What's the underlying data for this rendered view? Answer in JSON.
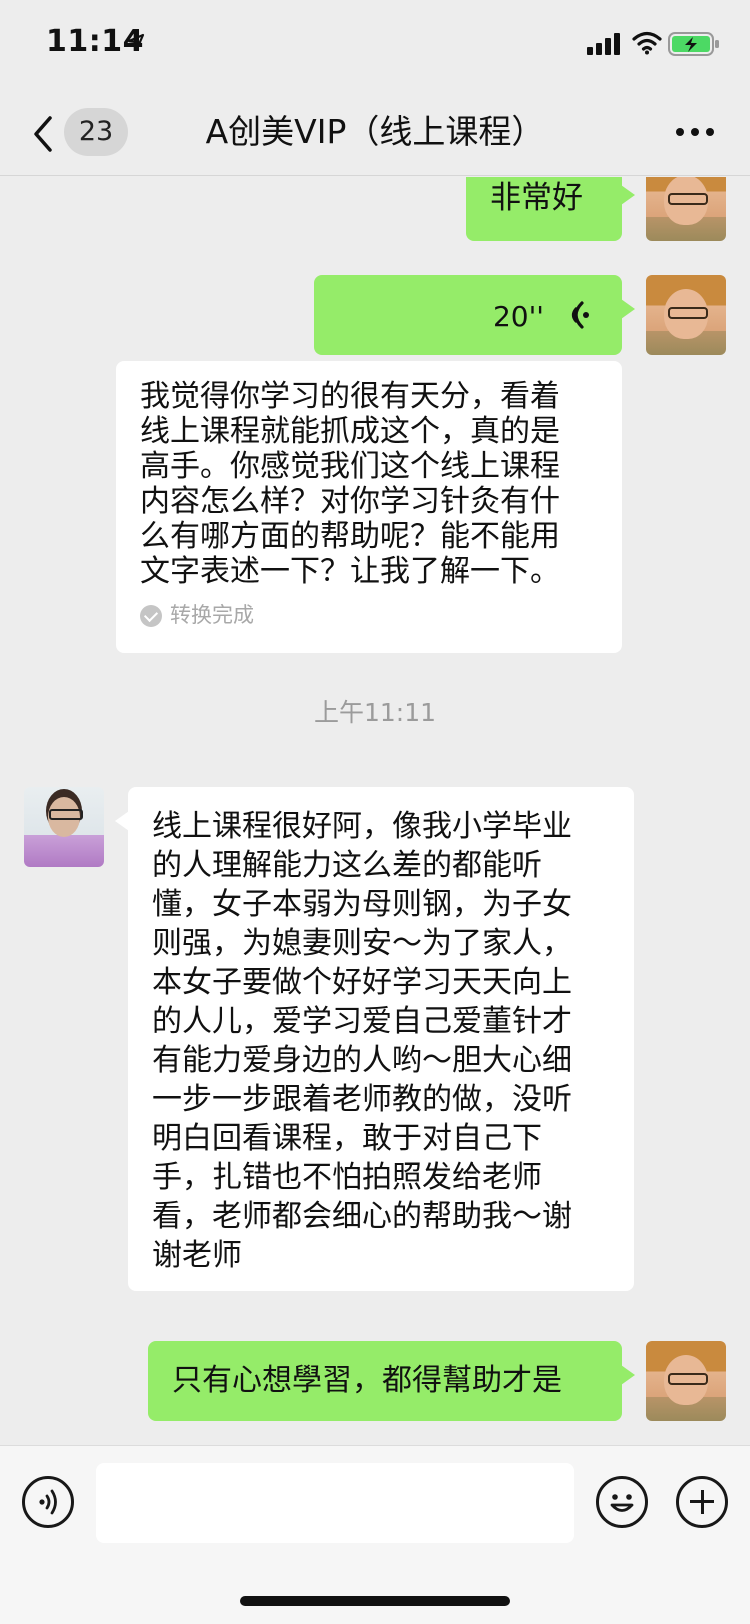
{
  "status_bar": {
    "time": "11:14",
    "icons": [
      "location-arrow-icon",
      "cellular-signal-icon",
      "wifi-icon",
      "battery-charging-icon"
    ]
  },
  "nav": {
    "unread_count": "23",
    "title": "A创美VIP（线上课程）",
    "icons": [
      "back-chevron-icon",
      "more-dots-icon"
    ]
  },
  "messages": [
    {
      "sender": "self",
      "type": "text",
      "text": "非常好"
    },
    {
      "sender": "self",
      "type": "voice",
      "duration": "20''",
      "transcript": "我觉得你学习的很有天分，看着\n线上课程就能抓成这个，真的是\n高手。你感觉我们这个线上课程\n内容怎么样？对你学习针灸有什\n么有哪方面的帮助呢？能不能用\n文字表述一下？让我了解一下。",
      "transcript_status": "转换完成"
    },
    {
      "type": "timestamp",
      "text": "上午11:11"
    },
    {
      "sender": "other",
      "type": "text",
      "text": "线上课程很好阿，像我小学毕业\n的人理解能力这么差的都能听\n懂，女子本弱为母则钢，为子女\n则强，为媳妻则安～为了家人，\n本女子要做个好好学习天天向上\n的人儿，爱学习爱自己爱董针才\n有能力爱身边的人哟～胆大心细\n一步一步跟着老师教的做，没听\n明白回看课程，敢于对自己下\n手，扎错也不怕拍照发给老师\n看，老师都会细心的帮助我～谢\n谢老师"
    },
    {
      "sender": "self",
      "type": "text",
      "text": "只有心想學習，都得幫助才是"
    }
  ],
  "input_bar": {
    "placeholder": "",
    "icons": [
      "voice-mode-icon",
      "emoji-icon",
      "plus-icon"
    ]
  },
  "colors": {
    "self_bubble": "#95ec69",
    "other_bubble": "#ffffff",
    "background": "#ededed"
  }
}
